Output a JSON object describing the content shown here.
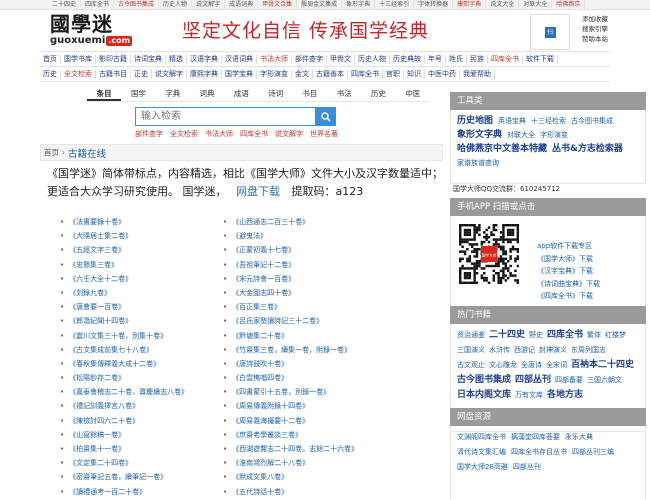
{
  "topbar": {
    "items": [
      "二十四史",
      "四库全书",
      "古今图书集成",
      "历史人物",
      "说文解字",
      "成语词典",
      "甲骨文合集",
      "殷周金文集成",
      "象形字典",
      "十三经索引",
      "字体转换器",
      "康熙字典",
      "说文大全",
      "对联大全",
      "哈佛燕京"
    ]
  },
  "header": {
    "logo_cn": "國學迷",
    "logo_en": "guoxuemi",
    "logo_suffix": ".com",
    "slogan": "坚定文化自信  传承国学经典",
    "qr_label": "扫",
    "qr_links": [
      "添加收藏",
      "搜索引擎",
      "赞助本站"
    ]
  },
  "nav": {
    "row1": [
      "首页",
      "国学书库",
      "影印古籍",
      "诗词宝典",
      "精选",
      "汉语字典",
      "汉语词典",
      "书法大师",
      "部件查字",
      "甲骨文",
      "历史人物",
      "历史典故",
      "年号",
      "姓氏",
      "民族",
      "四库全书",
      "软件下载"
    ],
    "row2": [
      "历史",
      "全文检索",
      "古籍书目",
      "正史",
      "说文解字",
      "康熙字典",
      "国学宝典",
      "字形演变",
      "金文",
      "古籍善本",
      "四库全书",
      "官职",
      "知识",
      "中医中药",
      "我爱帮助"
    ]
  },
  "search": {
    "tabs": [
      "条目",
      "国学",
      "字典",
      "词典",
      "成语",
      "诗词",
      "书目",
      "书法",
      "历史",
      "中医"
    ],
    "active_tab": "条目",
    "placeholder": "输入检索",
    "hot": [
      "部件查字",
      "全文检索",
      "书法大师",
      "四库全书",
      "说文解字",
      "世界名著"
    ]
  },
  "breadcrumb": {
    "home": "首页",
    "sep": "›",
    "current": "古籍在线"
  },
  "intro": {
    "text": "《国学迷》简体带标点，内容精选，相比《国学大师》文件大小及汉字数量适中；更适合大众学习研究使用。 国学迷，",
    "download_label": "网盘下载",
    "code_text": "提取码：a123"
  },
  "books": {
    "col1": [
      "《法書要錄十卷》",
      "《大隱居士集二卷》",
      "《五經文字三卷》",
      "《忠懸集三卷》",
      "《六壬大全十二卷》",
      "《剡錄九卷》",
      "《唐會要一百卷》",
      "《郎潛紀聞十四卷》",
      "《震川文集三十卷，別集十卷》",
      "《古文集成前集七十八卷》",
      "《春秋集傳釋義大成十二卷》",
      "《松陽鈔存二卷》",
      "《嘉泰會稽志二十卷，寶慶續志八卷》",
      "《禮記訓義擇言八卷》",
      "《陳檢討四六二十卷》",
      "《山窗餘稿一卷》",
      "《柏齋集十一卷》",
      "《文定集二十四卷》",
      "《密齋筆記五卷，續筆記一卷》",
      "《讀禮通考一百二十卷》"
    ],
    "col2": [
      "《山西通志二百三十卷》",
      "《避鬼法》",
      "《正蒙初義十七卷》",
      "《吾祖筆記十二卷》",
      "《宋元詩會一百卷》",
      "《大金國志四十卷》",
      "《百正集三卷》",
      "《呂氏家塾讀詩記三十二卷》",
      "《黔塘集二十卷》",
      "《竹齋集三卷，續集一卷，附錄一卷》",
      "《唐詩鼓吹十卷》",
      "《白雲樵唱四卷》",
      "《四書蒙引十五卷，別錄一卷》",
      "《周易傳義附錄十四卷》",
      "《周易義海撮要十二卷》",
      "《庶齋老學叢談三卷》",
      "《西湖遊覽志二十四卷，志餘二十六卷》",
      "《淮南鴻烈解二十八卷》",
      "《默成文集八卷》",
      "《五代詩話十卷》"
    ]
  },
  "sidebar": {
    "tools_title": "工具类",
    "tools": [
      {
        "t": "历史地图",
        "big": true
      },
      {
        "t": "英语宝典",
        "big": false
      },
      {
        "t": "十三经检索",
        "big": false
      },
      {
        "t": "古今图书集成",
        "big": false
      },
      {
        "t": "象形文字典",
        "big": true
      },
      {
        "t": "对联大全",
        "big": false
      },
      {
        "t": "字形演变",
        "big": false
      },
      {
        "t": "哈佛燕京中文善本特藏",
        "big": true
      },
      {
        "t": "丛书&方志检索器",
        "big": true
      },
      {
        "t": "家谱族谱查询",
        "big": false
      }
    ],
    "qq": "国学大师QQ交流群：610245712",
    "app_title": "手机APP 扫描或点击",
    "app_links": [
      "app软件下载专区",
      "《国学大师》下载",
      "《汉字宝典》下载",
      "《诗词曲宝典》下载",
      "《四库全书》下载"
    ],
    "app_badge": "国学大师",
    "books_title": "热门书籍",
    "hot_books": [
      {
        "t": "资治通鉴",
        "big": false
      },
      {
        "t": "二十四史",
        "big": true
      },
      {
        "t": "野史",
        "big": false
      },
      {
        "t": "四库全书",
        "big": true
      },
      {
        "t": "繁体",
        "big": false
      },
      {
        "t": "红楼梦",
        "big": false
      },
      {
        "t": "三国演义",
        "big": false
      },
      {
        "t": "水浒传",
        "big": false
      },
      {
        "t": "西游记",
        "big": false
      },
      {
        "t": "封神演义",
        "big": false
      },
      {
        "t": "东周列国志",
        "big": false
      },
      {
        "t": "古文观止",
        "big": false
      },
      {
        "t": "文心雕龙",
        "big": false
      },
      {
        "t": "全唐诗",
        "big": false
      },
      {
        "t": "全宋词",
        "big": false
      },
      {
        "t": "百衲本二十四史",
        "big": true
      },
      {
        "t": "古今图书集成",
        "big": true
      },
      {
        "t": "四部丛刊",
        "big": true
      },
      {
        "t": "四部备要",
        "big": false
      },
      {
        "t": "三国六朝文",
        "big": false
      },
      {
        "t": "日本内阁文库",
        "big": true
      },
      {
        "t": "万有文库",
        "big": false
      },
      {
        "t": "各地方志",
        "big": true
      }
    ],
    "res_title": "网盘资源",
    "resources": [
      "文渊阁四库全书",
      "摛藻堂四库荟要",
      "永乐大典",
      "清代诗文集汇编",
      "四库全书存目丛书",
      "四部丛刊三编",
      "国学大师28高雅",
      "四部丛刊"
    ]
  }
}
